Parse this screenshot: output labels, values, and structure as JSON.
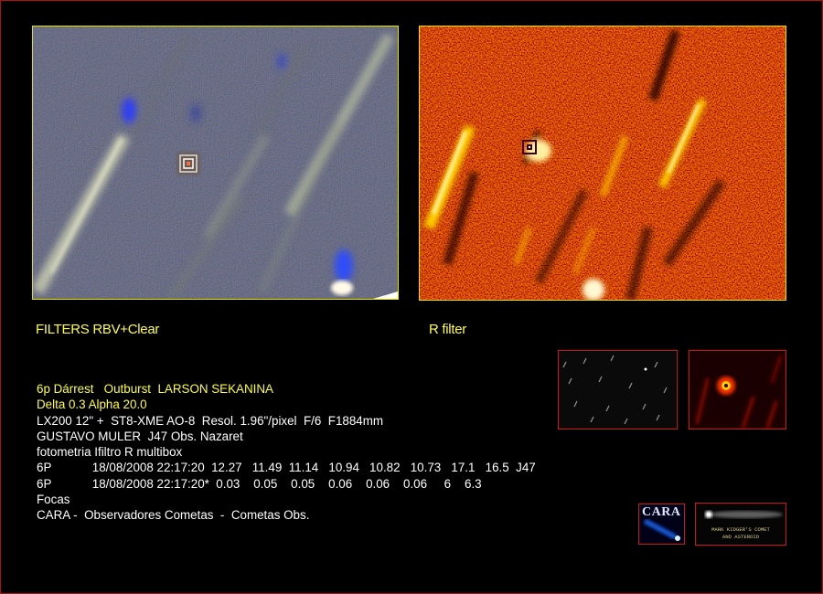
{
  "captions": {
    "left": "FILTERS RBV+Clear",
    "right": "R filter"
  },
  "info": {
    "line1": "6p Dárrest   Outburst  LARSON SEKANINA",
    "line2": "Delta 0.3 Alpha 20.0",
    "line3": "LX200 12\" +  ST8-XME AO-8  Resol. 1.96\"/pixel  F/6  F1884mm",
    "line4": "GUSTAVO MULER  J47 Obs. Nazaret",
    "line5": "fotometria Ifiltro R multibox",
    "line6": "6P            18/08/2008 22:17:20  12.27   11.49  11.14   10.94   10.82   10.73   17.1   16.5  J47",
    "line7": "6P            18/08/2008 22:17:20*  0.03    0.05    0.05    0.06    0.06    0.06     6    6.3",
    "line8": "Focas",
    "line9": "CARA -  Observadores Cometas  -  Cometas Obs."
  },
  "logos": {
    "cara": "CARA",
    "mark": "MARK KIDGER'S COMET\nAND ASTEROID"
  },
  "colors": {
    "caption": "#ffff33",
    "frame": "#b01010",
    "image_border": "#e4e400",
    "thumb_border": "#d01515"
  }
}
